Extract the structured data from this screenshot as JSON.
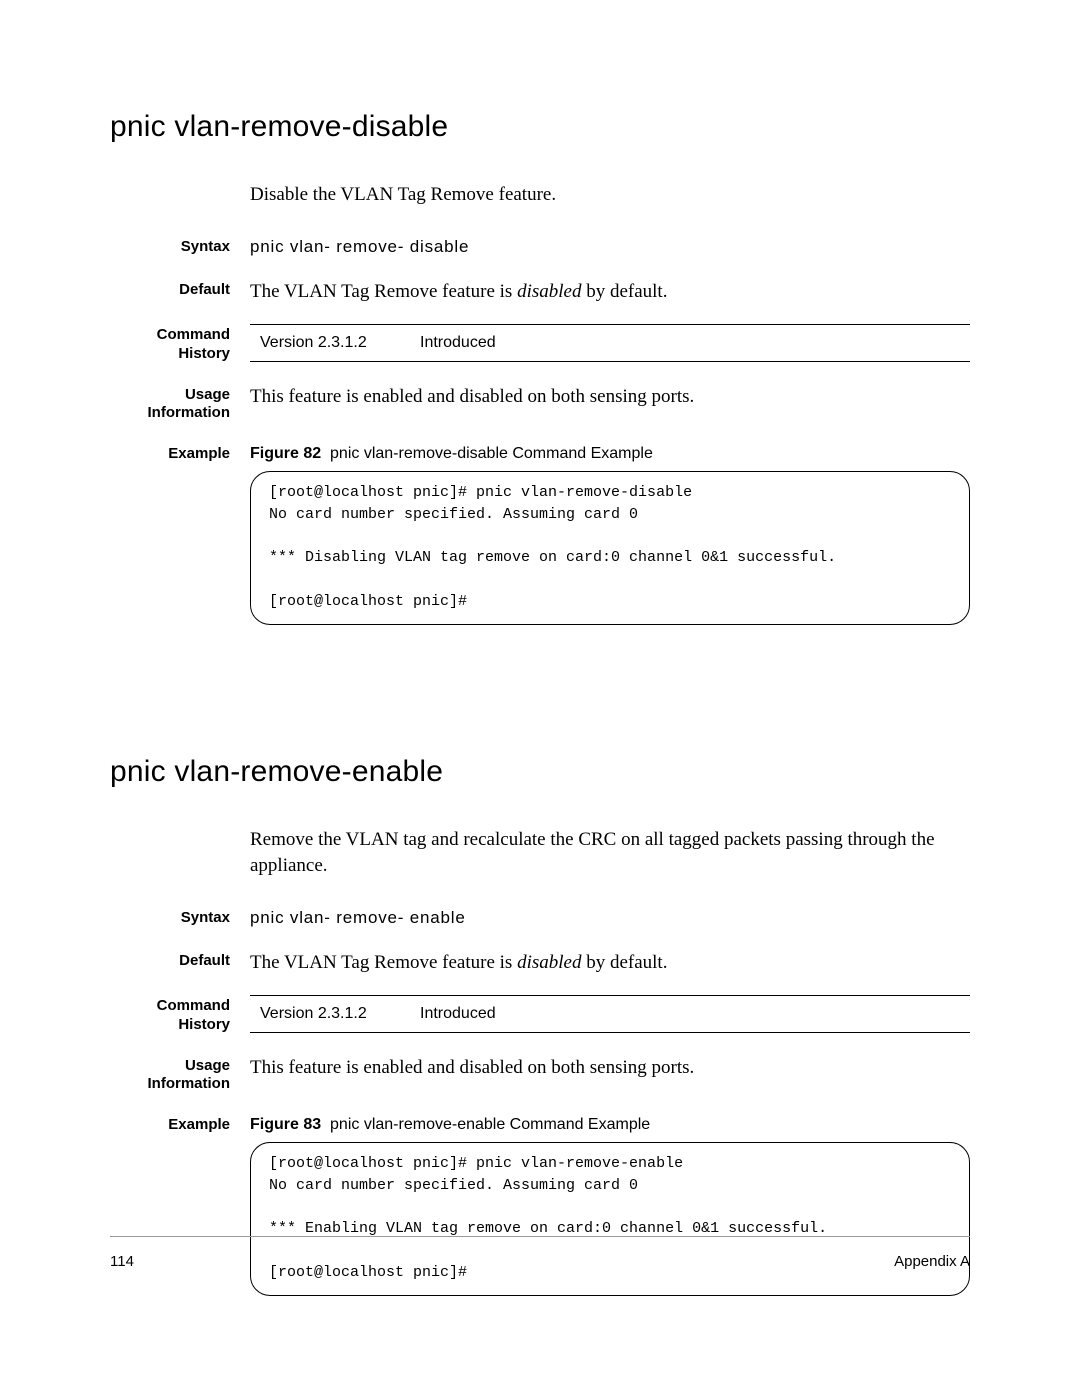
{
  "sections": [
    {
      "title": "pnic vlan-remove-disable",
      "intro": "Disable the VLAN Tag Remove feature.",
      "syntax_label": "Syntax",
      "syntax_value": "pnic vlan- remove- disable",
      "default_label": "Default",
      "default_pre": "The VLAN Tag Remove feature is ",
      "default_em": "disabled",
      "default_post": " by default.",
      "history_label": "Command\nHistory",
      "history_version": "Version 2.3.1.2",
      "history_note": "Introduced",
      "usage_label": "Usage\nInformation",
      "usage_text": "This feature is enabled and disabled on both sensing ports.",
      "example_label": "Example",
      "figure_label": "Figure 82",
      "figure_caption": "pnic vlan-remove-disable Command Example",
      "code": "[root@localhost pnic]# pnic vlan-remove-disable\nNo card number specified. Assuming card 0\n\n*** Disabling VLAN tag remove on card:0 channel 0&1 successful.\n\n[root@localhost pnic]#"
    },
    {
      "title": "pnic vlan-remove-enable",
      "intro": "Remove the VLAN tag and recalculate the CRC on all tagged packets passing through the appliance.",
      "syntax_label": "Syntax",
      "syntax_value": "pnic vlan- remove- enable",
      "default_label": "Default",
      "default_pre": "The VLAN Tag Remove feature is ",
      "default_em": "disabled",
      "default_post": " by default.",
      "history_label": "Command\nHistory",
      "history_version": "Version 2.3.1.2",
      "history_note": "Introduced",
      "usage_label": "Usage\nInformation",
      "usage_text": "This feature is enabled and disabled on both sensing ports.",
      "example_label": "Example",
      "figure_label": "Figure 83",
      "figure_caption": "pnic vlan-remove-enable Command Example",
      "code": "[root@localhost pnic]# pnic vlan-remove-enable\nNo card number specified. Assuming card 0\n\n*** Enabling VLAN tag remove on card:0 channel 0&1 successful.\n\n[root@localhost pnic]#"
    }
  ],
  "footer": {
    "page_number": "114",
    "appendix": "Appendix A"
  }
}
